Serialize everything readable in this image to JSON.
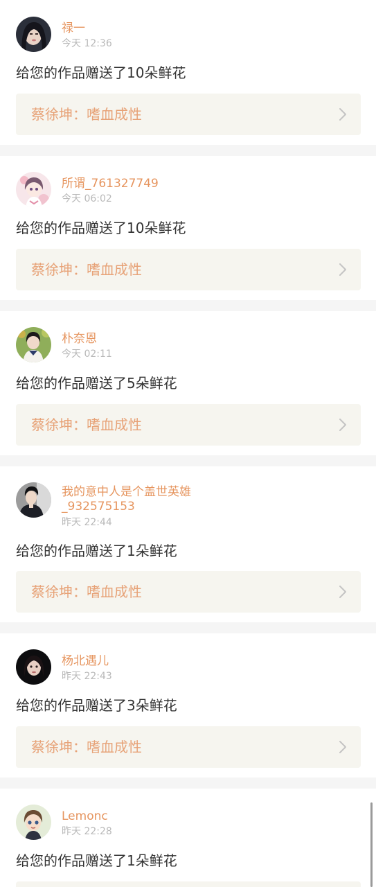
{
  "feed": {
    "items": [
      {
        "user": "禄一",
        "time": "今天 12:36",
        "message": "给您的作品赠送了10朵鲜花",
        "work": "蔡徐坤：嗜血成性",
        "avatar_icon": "avatar-dark-hair-girl"
      },
      {
        "user": "所谓_761327749",
        "time": "今天 06:02",
        "message": "给您的作品赠送了10朵鲜花",
        "work": "蔡徐坤：嗜血成性",
        "avatar_icon": "avatar-anime-girl-pink"
      },
      {
        "user": "朴奈恩",
        "time": "今天 02:11",
        "message": "给您的作品赠送了5朵鲜花",
        "work": "蔡徐坤：嗜血成性",
        "avatar_icon": "avatar-schoolgirl-garden"
      },
      {
        "user": "我的意中人是个盖世英雄\n_932575153",
        "time": "昨天 22:44",
        "message": "给您的作品赠送了1朵鲜花",
        "work": "蔡徐坤：嗜血成性",
        "avatar_icon": "avatar-boy-dark-jacket"
      },
      {
        "user": "杨北遇儿",
        "time": "昨天 22:43",
        "message": "给您的作品赠送了3朵鲜花",
        "work": "蔡徐坤：嗜血成性",
        "avatar_icon": "avatar-girl-black-bg"
      },
      {
        "user": "Lemonc",
        "time": "昨天 22:28",
        "message": "给您的作品赠送了1朵鲜花",
        "work": "",
        "avatar_icon": "avatar-cartoon-girl"
      }
    ]
  },
  "colors": {
    "username": "#e6955f",
    "time": "#b9b9b9",
    "message": "#333333",
    "work_title": "#e7a277",
    "work_bg": "#f6f5ef",
    "separator": "#f5f5f5",
    "chevron": "#c4c4c4"
  },
  "icons": {
    "chevron": "chevron-right-icon"
  }
}
